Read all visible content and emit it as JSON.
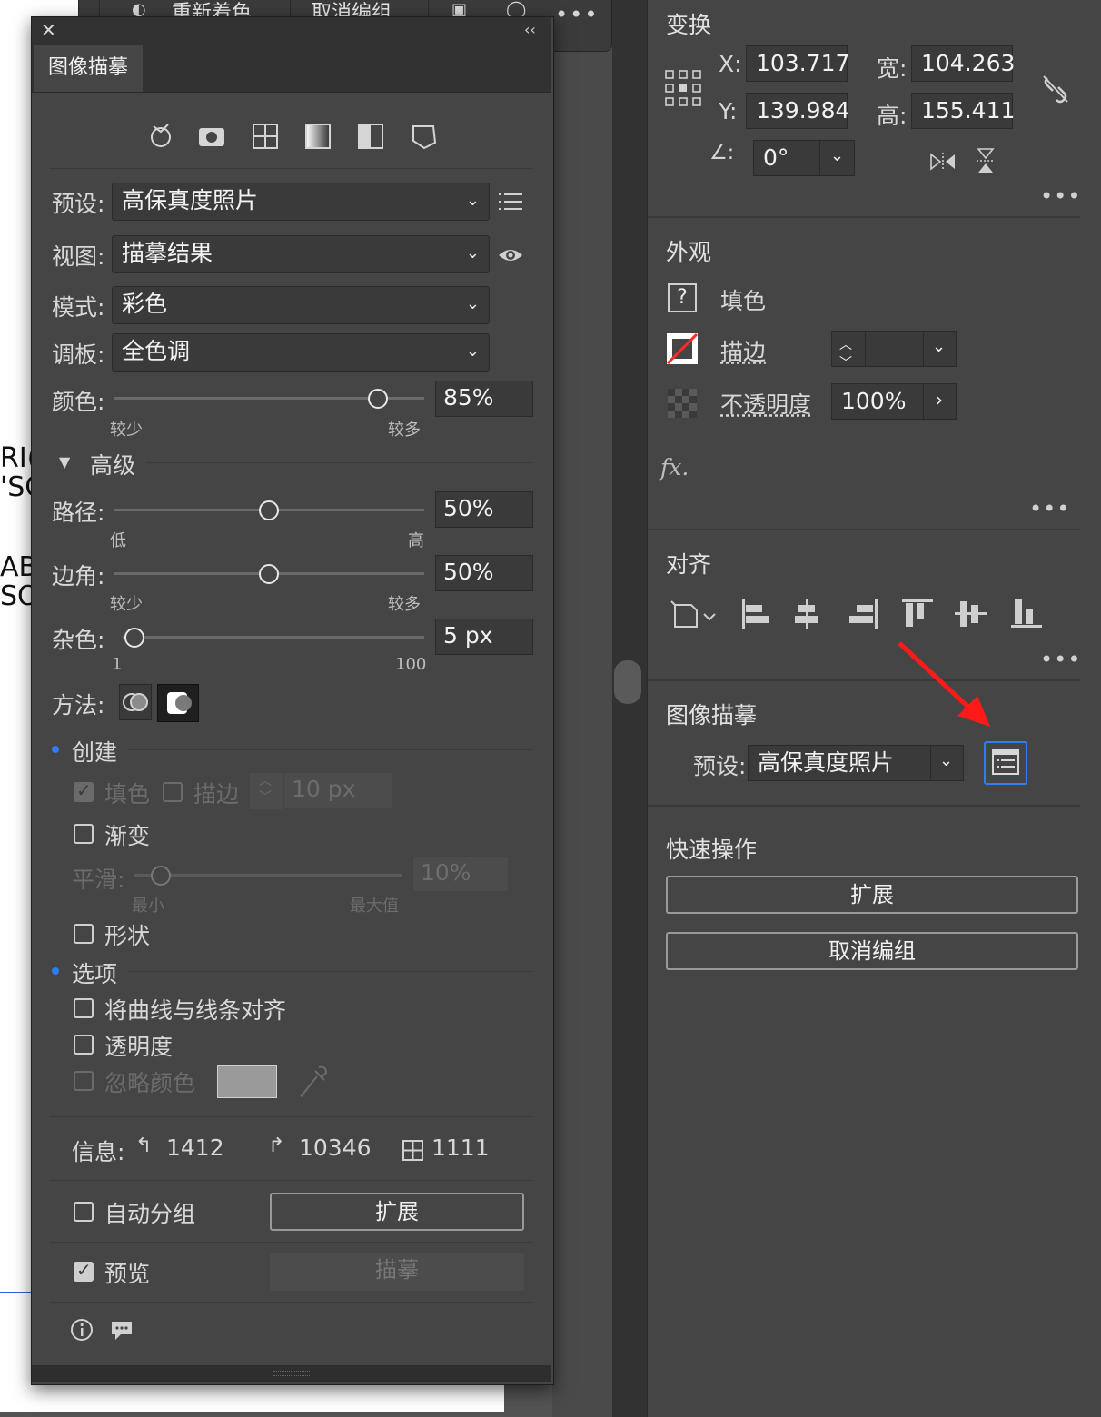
{
  "canvas": {
    "text_lines": [
      "RI(",
      "'SO",
      "ABL",
      "SOF"
    ]
  },
  "top_toolbar": {
    "items": [
      "重新着色",
      "取消编组"
    ]
  },
  "trace_panel": {
    "tab": "图像描摹",
    "preset": {
      "label": "预设:",
      "value": "高保真度照片"
    },
    "view": {
      "label": "视图:",
      "value": "描摹结果"
    },
    "mode": {
      "label": "模式:",
      "value": "彩色"
    },
    "palette": {
      "label": "调板:",
      "value": "全色调"
    },
    "colors": {
      "label": "颜色:",
      "value": "85%",
      "min_label": "较少",
      "max_label": "较多",
      "level": 0.85
    },
    "advanced_label": "高级",
    "paths": {
      "label": "路径:",
      "value": "50%",
      "min_label": "低",
      "max_label": "高",
      "level": 0.5
    },
    "corners": {
      "label": "边角:",
      "value": "50%",
      "min_label": "较少",
      "max_label": "较多",
      "level": 0.5
    },
    "noise": {
      "label": "杂色:",
      "value": "5 px",
      "min_label": "1",
      "max_label": "100",
      "level": 0.04
    },
    "method_label": "方法:",
    "create": {
      "label": "创建",
      "fill_label": "填色",
      "stroke_label": "描边",
      "stroke_value": "10 px",
      "gradient_label": "渐变",
      "smooth_label": "平滑:",
      "smooth_value": "10%",
      "smooth_min": "最小",
      "smooth_max": "最大值",
      "smooth_level": 0.1,
      "shape_label": "形状"
    },
    "options": {
      "label": "选项",
      "snap_label": "将曲线与线条对齐",
      "transparency_label": "透明度",
      "ignore_label": "忽略颜色",
      "ignore_swatch": "#9a9a9a"
    },
    "info": {
      "label": "信息:",
      "paths": "1412",
      "anchors": "10346",
      "colors": "1111"
    },
    "auto_group_label": "自动分组",
    "expand_label": "扩展",
    "preview_label": "预览",
    "trace_label": "描摹"
  },
  "properties": {
    "transform": {
      "title": "变换",
      "x_label": "X:",
      "x": "103.717",
      "y_label": "Y:",
      "y": "139.984",
      "w_label": "宽:",
      "w": "104.263",
      "h_label": "高:",
      "h": "155.411",
      "angle": "0°"
    },
    "appearance": {
      "title": "外观",
      "fill_label": "填色",
      "stroke_label": "描边",
      "opacity_label": "不透明度",
      "opacity_value": "100%",
      "fx_label": "fx."
    },
    "align": {
      "title": "对齐"
    },
    "image_trace": {
      "title": "图像描摹",
      "preset_label": "预设:",
      "preset_value": "高保真度照片"
    },
    "quick_actions": {
      "title": "快速操作",
      "expand": "扩展",
      "ungroup": "取消编组"
    }
  },
  "colors": {
    "accent": "#2f7cf6",
    "annotation_arrow": "#ff1a1a"
  }
}
